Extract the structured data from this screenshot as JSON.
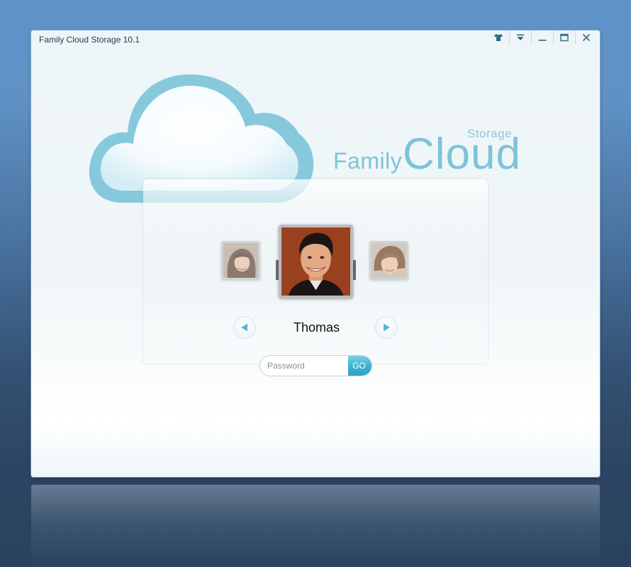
{
  "window": {
    "title": "Family Cloud Storage 10.1",
    "controls": [
      {
        "name": "skin-icon",
        "label": "Skin"
      },
      {
        "name": "menu-icon",
        "label": "Menu"
      },
      {
        "name": "minimize-icon",
        "label": "Minimize"
      },
      {
        "name": "maximize-icon",
        "label": "Maximize"
      },
      {
        "name": "close-icon",
        "label": "Close"
      }
    ]
  },
  "logo": {
    "family": "Family",
    "cloud": "Cloud",
    "storage": "Storage"
  },
  "login": {
    "current_user": "Thomas",
    "password_placeholder": "Password",
    "password_value": "",
    "go_label": "GO"
  },
  "colors": {
    "accent": "#7ec3d8",
    "go_button": "#3fb1d2",
    "window_bg": "#eef5f8",
    "desktop_top": "#5f93c9",
    "desktop_bottom": "#2a425d"
  }
}
